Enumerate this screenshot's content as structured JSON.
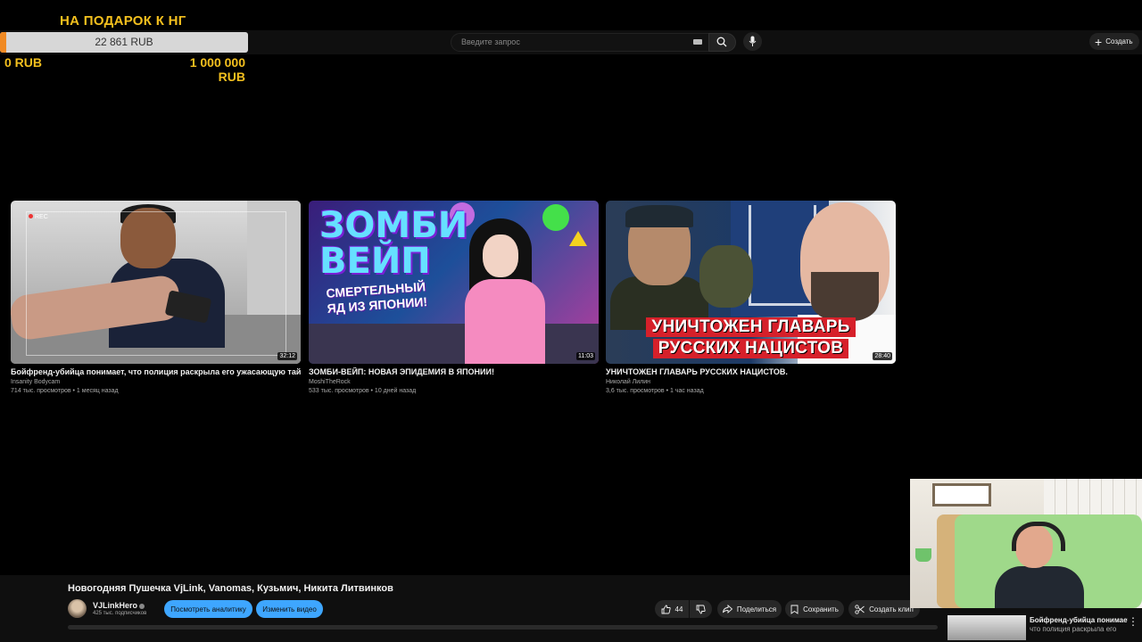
{
  "donation": {
    "title": "НА ПОДАРОК К НГ",
    "current": "22 861 RUB",
    "min": "0 RUB",
    "max_line1": "1 000 000",
    "max_line2": "RUB",
    "progress_fraction": 0.0229
  },
  "header": {
    "search_placeholder": "Введите запрос",
    "create_label": "Создать"
  },
  "videos": [
    {
      "title": "Бойфренд-убийца понимает, что полиция раскрыла его ужасающую тайну",
      "channel": "Insanity Bodycam",
      "meta": "714 тыс. просмотров • 1 месяц назад",
      "duration": "32:12",
      "thumb_rec": "REC"
    },
    {
      "title": "ЗОМБИ-ВЕЙП: НОВАЯ ЭПИДЕМИЯ В ЯПОНИИ!",
      "channel": "MoshiTheRock",
      "meta": "533 тыс. просмотров • 10 дней назад",
      "duration": "11:03",
      "thumb_big_line1": "ЗОМБИ",
      "thumb_big_line2": "ВЕЙП",
      "thumb_sub_line1": "СМЕРТЕЛЬНЫЙ",
      "thumb_sub_line2": "ЯД ИЗ ЯПОНИИ!"
    },
    {
      "title": "УНИЧТОЖЕН ГЛАВАРЬ РУССКИХ НАЦИСТОВ.",
      "channel": "Николай Лилин",
      "meta": "3,6 тыс. просмотров • 1 час назад",
      "duration": "28:40",
      "thumb_banner_line1": "УНИЧТОЖЕН ГЛАВАРЬ",
      "thumb_banner_line2": "РУССКИХ НАЦИСТОВ"
    }
  ],
  "current_video": {
    "title": "Новогодняя Пушечка VjLink, Vanomas, Кузьмич, Никита Литвинков",
    "channel": "VJLinkHero",
    "subscribers": "425 тыс. подписчиков",
    "analytics_label": "Посмотреть аналитику",
    "edit_label": "Изменить видео",
    "likes": "44",
    "share_label": "Поделиться",
    "save_label": "Сохранить",
    "clip_label": "Создать клип"
  },
  "mini_player": {
    "title_line1": "Бойфренд-убийца понимает,",
    "title_line2": "что полиция раскрыла его"
  }
}
